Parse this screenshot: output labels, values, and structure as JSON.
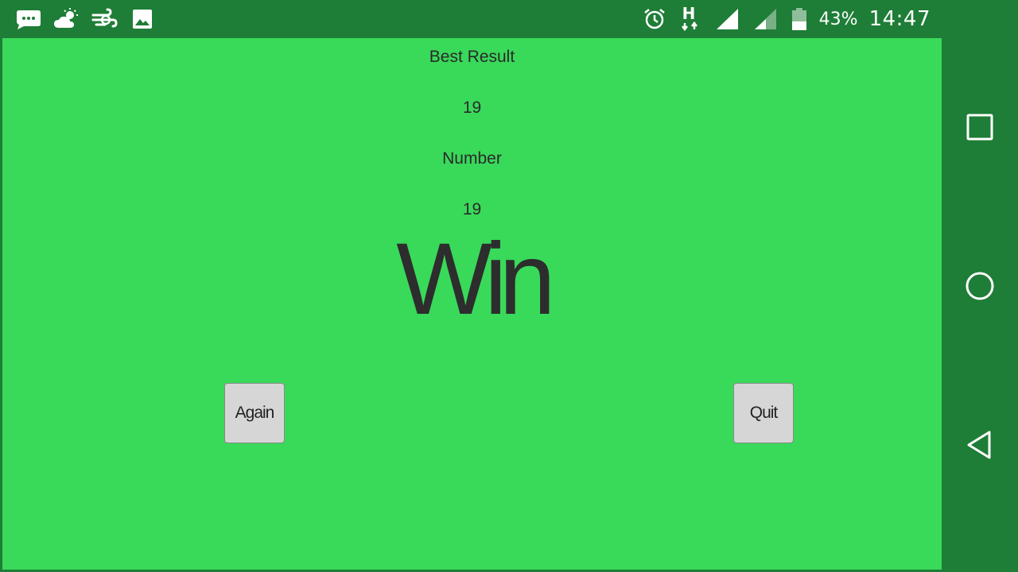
{
  "status_bar": {
    "battery_percent": "43%",
    "time": "14:47",
    "network_type": "H",
    "icons": [
      "message-icon",
      "weather-icon",
      "wind-icon",
      "image-icon",
      "alarm-icon",
      "signal-icon",
      "signal-weak-icon",
      "battery-icon"
    ]
  },
  "game": {
    "best_result_label": "Best Result",
    "best_result_value": "19",
    "number_label": "Number",
    "number_value": "19",
    "result_text": "Win",
    "again_label": "Again",
    "quit_label": "Quit"
  },
  "nav_bar": {
    "icons": [
      "recent-apps-icon",
      "home-icon",
      "back-icon"
    ]
  },
  "colors": {
    "game_background": "#39d95a",
    "system_bar": "#1e7d36",
    "button_background": "#d6d6d6",
    "text": "#2d2d2d"
  }
}
